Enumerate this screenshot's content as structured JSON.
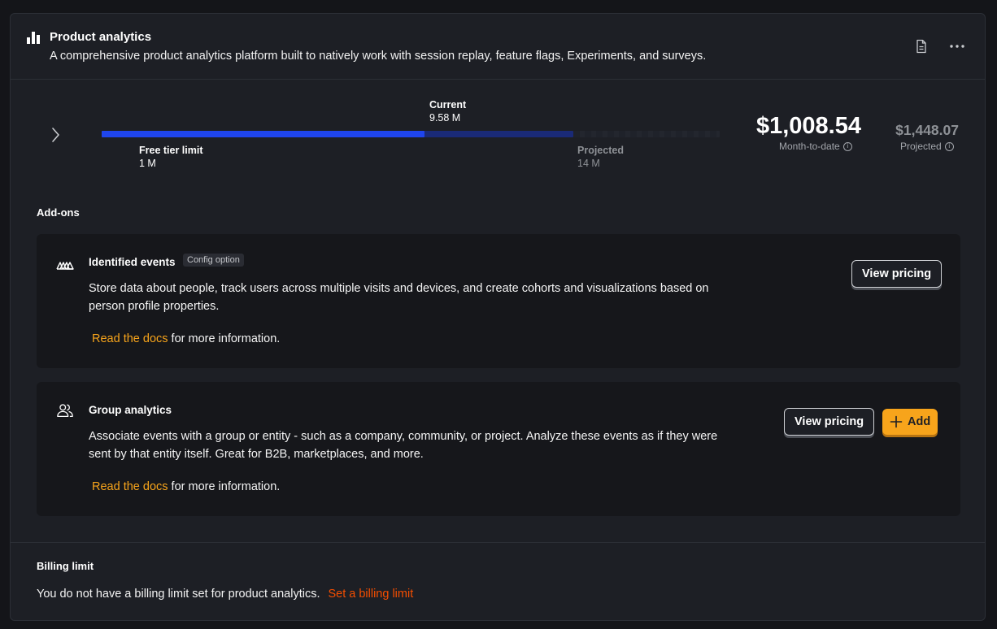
{
  "product": {
    "icon": "bar-chart-icon",
    "title": "Product analytics",
    "description": "A comprehensive product analytics platform built to natively work with session replay, feature flags, Experiments, and surveys."
  },
  "header_actions": {
    "docs_icon": "document-icon",
    "more_icon": "more-horizontal-icon"
  },
  "usage": {
    "current_label": "Current",
    "current_value": "9.58 M",
    "free_tier_label": "Free tier limit",
    "free_tier_value": "1 M",
    "projected_label": "Projected",
    "projected_value": "14 M",
    "current_fraction": 0.684
  },
  "costs": {
    "month_to_date_amount": "$1,008.54",
    "month_to_date_label": "Month-to-date",
    "projected_amount": "$1,448.07",
    "projected_label": "Projected"
  },
  "addons": {
    "section_title": "Add-ons",
    "items": [
      {
        "icon": "identified-events-icon",
        "title": "Identified events",
        "badge": "Config option",
        "description": "Store data about people, track users across multiple visits and devices, and create cohorts and visualizations based on person profile properties.",
        "docs_link": "Read the docs",
        "docs_suffix": " for more information.",
        "view_pricing": "View pricing"
      },
      {
        "icon": "people-icon",
        "title": "Group analytics",
        "description": "Associate events with a group or entity - such as a company, community, or project. Analyze these events as if they were sent by that entity itself. Great for B2B, marketplaces, and more.",
        "docs_link": "Read the docs",
        "docs_suffix": " for more information.",
        "view_pricing": "View pricing",
        "add_label": "Add"
      }
    ]
  },
  "billing_limit": {
    "title": "Billing limit",
    "text": "You do not have a billing limit set for product analytics.",
    "link": "Set a billing limit"
  },
  "colors": {
    "accent_orange": "#f7a41b",
    "link_red_orange": "#f54e00",
    "bar_blue": "#1f45ee"
  }
}
